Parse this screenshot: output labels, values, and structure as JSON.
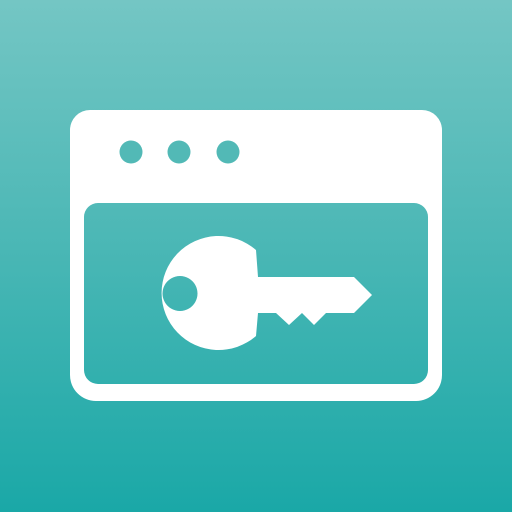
{
  "app_icon": {
    "icon": "browser-window-key-icon",
    "colors": {
      "background_top": "#74c6c4",
      "background_bottom": "#1aa8a7",
      "glyph": "#ffffff",
      "dot_fill": "#52b9b6"
    },
    "window_dots": 3
  }
}
